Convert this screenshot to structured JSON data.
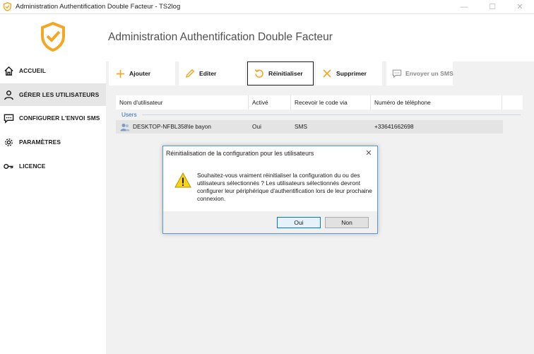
{
  "window": {
    "title": "Administration Authentification Double Facteur - TS2log",
    "min_glyph": "—",
    "max_glyph": "☐",
    "close_glyph": "✕"
  },
  "colors": {
    "accent_orange": "#f5a623",
    "nav_active_bg": "#e6e6e6",
    "content_bg": "#f1f1f1",
    "group_blue": "#2e6bb8",
    "dialog_border": "#5a9bd5"
  },
  "sidebar": {
    "logo_icon": "shield-check-icon",
    "items": [
      {
        "label": "ACCUEIL",
        "icon": "home-icon",
        "active": false
      },
      {
        "label": "GÉRER LES UTILISATEURS",
        "icon": "user-icon",
        "active": true
      },
      {
        "label": "CONFIGURER L'ENVOI SMS",
        "icon": "message-icon",
        "active": false
      },
      {
        "label": "PARAMÈTRES",
        "icon": "gear-icon",
        "active": false
      },
      {
        "label": "LICENCE",
        "icon": "key-icon",
        "active": false
      }
    ]
  },
  "main": {
    "title": "Administration Authentification Double Facteur"
  },
  "toolbar": {
    "add_label": "Ajouter",
    "edit_label": "Editer",
    "reset_label": "Réinitialiser",
    "delete_label": "Supprimer",
    "sms_label": "Envoyer un SMS"
  },
  "table": {
    "columns": [
      "Nom d'utilisateur",
      "Activé",
      "Recevoir le code via",
      "Numéro de téléphone",
      ""
    ],
    "group": "Users",
    "rows": [
      {
        "user": "DESKTOP-NFBL358\\le bayon",
        "active": "Oui",
        "via": "SMS",
        "phone": "+33641662698"
      }
    ]
  },
  "dialog": {
    "title": "Réinitialisation de la configuration pour les utilisateurs",
    "message": "Souhaitez-vous vraiment réinitialiser la configuration du ou des utilisateurs sélectionnés ? Les utilisateurs sélectionnés devront configurer leur périphérique d'authentification lors de leur prochaine connexion.",
    "close_glyph": "✕",
    "yes_label": "Oui",
    "no_label": "Non"
  }
}
